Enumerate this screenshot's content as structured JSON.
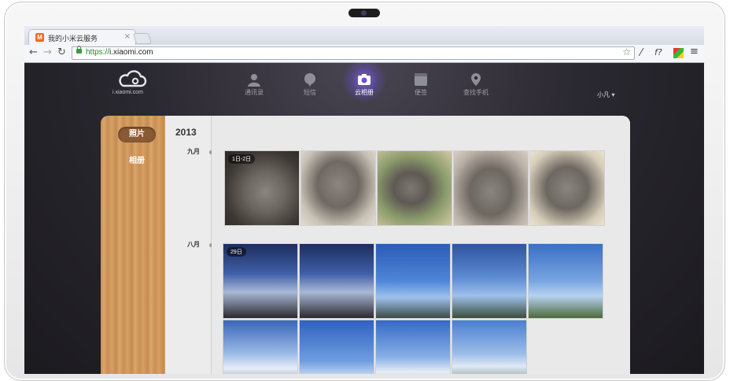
{
  "browser": {
    "tab_title": "我的小米云服务",
    "tab_favicon_letter": "M",
    "tab_close": "×",
    "url_scheme": "https://",
    "url_host": "i.xiaomi.com",
    "back": "←",
    "forward": "→",
    "reload": "↻",
    "star": "☆",
    "ext1": "⁄",
    "ext2": "f?",
    "menu": "≡"
  },
  "header": {
    "logo_text": "i.xiaomi.com",
    "nav": [
      {
        "label": "通讯录",
        "icon": "contacts-icon"
      },
      {
        "label": "短信",
        "icon": "sms-icon"
      },
      {
        "label": "云相册",
        "icon": "camera-icon"
      },
      {
        "label": "便签",
        "icon": "notes-icon"
      },
      {
        "label": "查找手机",
        "icon": "location-icon"
      }
    ],
    "active_index": 2,
    "user": "小凡 ▾"
  },
  "sidebar": {
    "items": [
      "照片",
      "相册"
    ],
    "active_index": 0
  },
  "timeline": {
    "year": "2013",
    "months": [
      "九月",
      "八月"
    ]
  },
  "photos": {
    "group1_badge": "1日-2日",
    "group2_badge": "29日"
  },
  "colors": {
    "accent_glow": "#8c6eff",
    "page_dark": "#2a2830",
    "wood": "#c68f55",
    "sidebar_active": "#8a5a34"
  }
}
